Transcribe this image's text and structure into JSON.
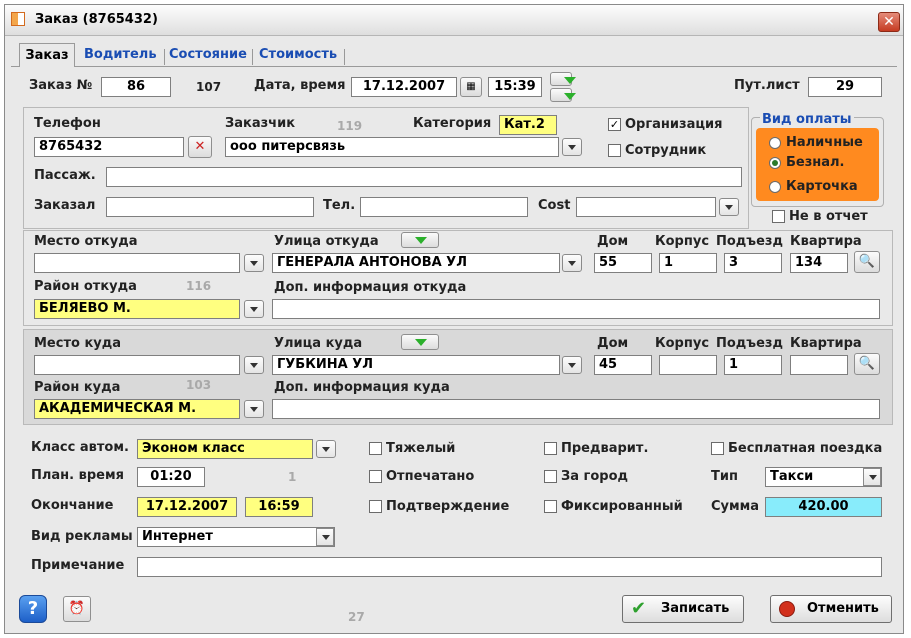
{
  "window": {
    "title": "Заказ  (8765432)",
    "close_glyph": "✕"
  },
  "tabs": [
    "Заказ",
    "Водитель",
    "Состояние",
    "Стоимость"
  ],
  "header": {
    "order_label": "Заказ №",
    "order_no": "86",
    "order_extra": "107",
    "datetime_label": "Дата, время",
    "date": "17.12.2007",
    "time": "15:39",
    "waybill_label": "Пут.лист",
    "waybill": "29"
  },
  "customer": {
    "phone_label": "Телефон",
    "phone": "8765432",
    "client_label": "Заказчик",
    "client_num": "119",
    "client": "ооо питерсвязь",
    "category_label": "Категория",
    "category": "Кат.2",
    "org_label": "Организация",
    "org_checked": true,
    "employee_label": "Сотрудник",
    "employee_checked": false,
    "passenger_label": "Пассаж.",
    "passenger": "",
    "ordered_by_label": "Заказал",
    "ordered_by": "",
    "tel_label": "Тел.",
    "tel": "",
    "cost_label": "Cost",
    "cost": ""
  },
  "payment": {
    "title": "Вид оплаты",
    "options": [
      "Наличные",
      "Безнал.",
      "Карточка"
    ],
    "selected": "Безнал.",
    "not_in_report_label": "Не в отчет",
    "accent": "#ff8a1f"
  },
  "from": {
    "place_label": "Место откуда",
    "place": "",
    "street_label": "Улица откуда",
    "street": "ГЕНЕРАЛА АНТОНОВА УЛ",
    "house_label": "Дом",
    "house": "55",
    "building_label": "Корпус",
    "building": "1",
    "entrance_label": "Подъезд",
    "entrance": "3",
    "flat_label": "Квартира",
    "flat": "134",
    "district_label": "Район откуда",
    "district_num": "116",
    "district": "БЕЛЯЕВО М.",
    "info_label": "Доп. информация откуда",
    "info": ""
  },
  "to": {
    "place_label": "Место куда",
    "place": "",
    "street_label": "Улица куда",
    "street": "ГУБКИНА УЛ",
    "house_label": "Дом",
    "house": "45",
    "building_label": "Корпус",
    "building": "",
    "entrance_label": "Подъезд",
    "entrance": "1",
    "flat_label": "Квартира",
    "flat": "",
    "district_label": "Район куда",
    "district_num": "103",
    "district": "АКАДЕМИЧЕСКАЯ М.",
    "info_label": "Доп. информация куда",
    "info": ""
  },
  "details": {
    "class_label": "Класс автом.",
    "class": "Эконом класс",
    "plan_label": "План. время",
    "plan_time": "01:20",
    "plan_extra": "1",
    "end_label": "Окончание",
    "end_date": "17.12.2007",
    "end_time": "16:59",
    "ad_label": "Вид рекламы",
    "ad": "Интернет",
    "note_label": "Примечание",
    "note": "",
    "heavy": "Тяжелый",
    "printed": "Отпечатано",
    "confirm": "Подтверждение",
    "prelim": "Предварит.",
    "outcity": "За город",
    "fixed": "Фиксированный",
    "free_ride": "Бесплатная поездка",
    "type_label": "Тип",
    "type": "Такси",
    "sum_label": "Сумма",
    "sum": "420.00"
  },
  "footer": {
    "save": "Записать",
    "cancel": "Отменить",
    "counter": "27",
    "help_glyph": "?"
  }
}
